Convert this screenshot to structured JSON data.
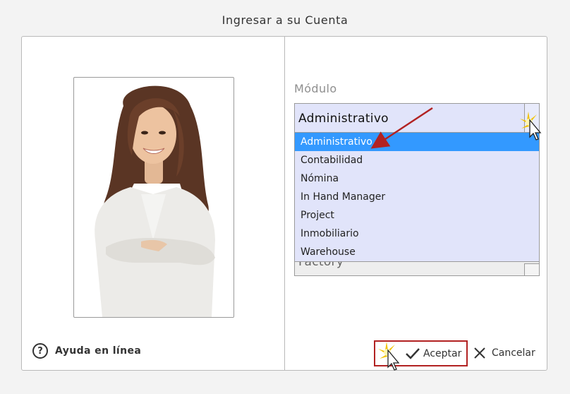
{
  "dialog": {
    "title": "Ingresar a su Cuenta"
  },
  "help": {
    "label": "Ayuda en línea",
    "icon": "help-icon"
  },
  "module": {
    "label": "Módulo",
    "selected": "Administrativo",
    "options": [
      "Administrativo",
      "Contabilidad",
      "Nómina",
      "In Hand Manager",
      "Project",
      "Inmobiliario",
      "Warehouse"
    ],
    "highlighted_index": 0
  },
  "second_select": {
    "value": "Factory"
  },
  "buttons": {
    "accept": "Aceptar",
    "cancel": "Cancelar"
  },
  "colors": {
    "accent": "#3399ff",
    "select_bg": "#e1e4fa",
    "annotation": "#b22222"
  }
}
